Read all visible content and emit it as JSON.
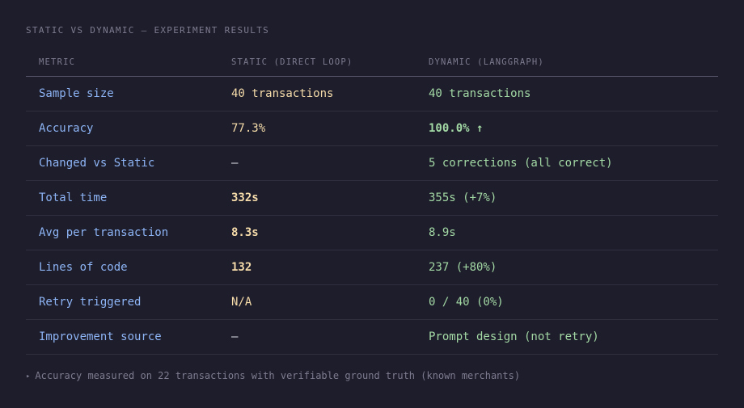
{
  "section_title": "STATIC VS DYNAMIC — EXPERIMENT RESULTS",
  "table": {
    "headers": {
      "metric": "METRIC",
      "static": "STATIC (DIRECT LOOP)",
      "dynamic": "DYNAMIC (LANGGRAPH)"
    },
    "rows": [
      {
        "metric": "Sample size",
        "static": "40 transactions",
        "dynamic": "40 transactions"
      },
      {
        "metric": "Accuracy",
        "static": "77.3%",
        "dynamic": "100.0% ↑"
      },
      {
        "metric": "Changed vs Static",
        "static": "—",
        "dynamic": "5 corrections (all correct)"
      },
      {
        "metric": "Total time",
        "static": "332s",
        "dynamic": "355s (+7%)"
      },
      {
        "metric": "Avg per transaction",
        "static": "8.3s",
        "dynamic": "8.9s"
      },
      {
        "metric": "Lines of code",
        "static": "132",
        "dynamic": "237 (+80%)"
      },
      {
        "metric": "Retry triggered",
        "static": "N/A",
        "dynamic": "0 / 40 (0%)"
      },
      {
        "metric": "Improvement source",
        "static": "—",
        "dynamic": "Prompt design (not retry)"
      }
    ]
  },
  "footnote": {
    "marker": "▸",
    "text": "Accuracy measured on 22 transactions with verifiable ground truth (known merchants)"
  },
  "colors": {
    "background": "#1e1d2b",
    "metric_text": "#8db4f5",
    "static_text": "#f6dcaa",
    "dynamic_text": "#a3d9a5",
    "muted_text": "#7d7b8f"
  }
}
